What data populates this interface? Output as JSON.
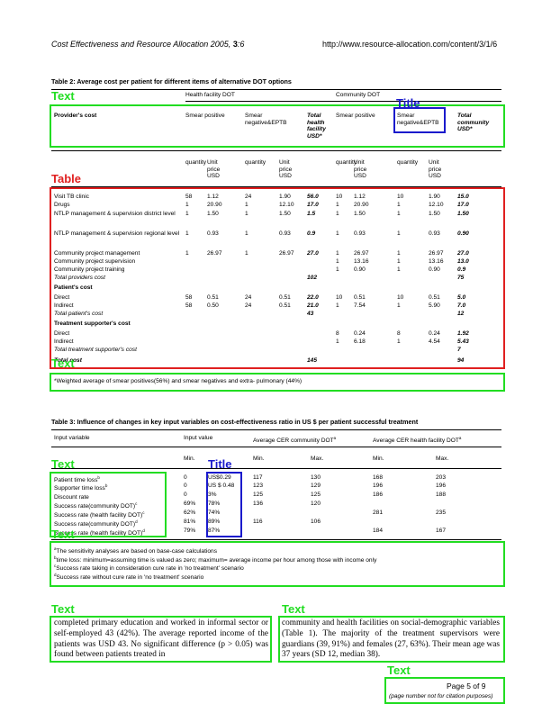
{
  "header": {
    "journal": "Cost Effectiveness and Resource Allocation",
    "citation_year": "2005,",
    "citation_vol": "3",
    "citation_page": ":6",
    "url": "http://www.resource-allocation.com/content/3/1/6"
  },
  "table2": {
    "caption": "Table 2: Average cost per patient for different items of alternative DOT options",
    "group_hf": "Health facility DOT",
    "group_cd": "Community DOT",
    "head_provider": "Provider's cost",
    "head_sp_hf": "Smear positive",
    "head_sn_hf": "Smear negative&EPTB",
    "head_total_hf": "Total health facility USD*",
    "head_sp_cd": "Smear positive",
    "head_sn_cd": "Smear negative&EPTB",
    "head_total_cd": "Total community USD*",
    "sub_qty": "quantity",
    "sub_unit": "Unit price USD",
    "rows": [
      {
        "label": "Visit TB clinic",
        "c": [
          "58",
          "1.12",
          "24",
          "1.90",
          "56.0",
          "10",
          "1.12",
          "10",
          "1.90",
          "15.0"
        ]
      },
      {
        "label": "Drugs",
        "c": [
          "1",
          "20.90",
          "1",
          "12.10",
          "17.0",
          "1",
          "20.90",
          "1",
          "12.10",
          "17.0"
        ]
      },
      {
        "label": "NTLP management & supervision district level",
        "c": [
          "1",
          "1.50",
          "1",
          "1.50",
          "1.5",
          "1",
          "1.50",
          "1",
          "1.50",
          "1.50"
        ]
      },
      {
        "label": "NTLP management & supervision regional level",
        "c": [
          "1",
          "0.93",
          "1",
          "0.93",
          "0.9",
          "1",
          "0.93",
          "1",
          "0.93",
          "0.90"
        ]
      },
      {
        "label": "Community project management",
        "c": [
          "1",
          "26.97",
          "1",
          "26.97",
          "27.0",
          "1",
          "26.97",
          "1",
          "26.97",
          "27.0"
        ]
      },
      {
        "label": "Community project supervision",
        "c": [
          "",
          "",
          "",
          "",
          "",
          "1",
          "13.16",
          "1",
          "13.16",
          "13.0"
        ]
      },
      {
        "label": "Community project training",
        "c": [
          "",
          "",
          "",
          "",
          "",
          "1",
          "0.90",
          "1",
          "0.90",
          "0.9"
        ]
      },
      {
        "label": "Total providers cost",
        "c": [
          "",
          "",
          "",
          "",
          "102",
          "",
          "",
          "",
          "",
          "75"
        ]
      },
      {
        "label": "Patient's cost",
        "c": [
          "",
          "",
          "",
          "",
          "",
          "",
          "",
          "",
          "",
          ""
        ]
      },
      {
        "label": "Direct",
        "c": [
          "58",
          "0.51",
          "24",
          "0.51",
          "22.0",
          "10",
          "0.51",
          "10",
          "0.51",
          "5.0"
        ]
      },
      {
        "label": "Indirect",
        "c": [
          "58",
          "0.50",
          "24",
          "0.51",
          "21.0",
          "1",
          "7.54",
          "1",
          "5.90",
          "7.0"
        ]
      },
      {
        "label": "Total patient's cost",
        "c": [
          "",
          "",
          "",
          "",
          "43",
          "",
          "",
          "",
          "",
          "12"
        ]
      },
      {
        "label": "Treatment supporter's cost",
        "c": [
          "",
          "",
          "",
          "",
          "",
          "",
          "",
          "",
          "",
          ""
        ]
      },
      {
        "label": "Direct",
        "c": [
          "",
          "",
          "",
          "",
          "",
          "8",
          "0.24",
          "8",
          "0.24",
          "1.92"
        ]
      },
      {
        "label": "Indirect",
        "c": [
          "",
          "",
          "",
          "",
          "",
          "1",
          "6.18",
          "1",
          "4.54",
          "5.43"
        ]
      },
      {
        "label": "Total treatment supporter's cost",
        "c": [
          "",
          "",
          "",
          "",
          "",
          "",
          "",
          "",
          "",
          "7"
        ]
      },
      {
        "label": "Total cost",
        "c": [
          "",
          "",
          "",
          "",
          "145",
          "",
          "",
          "",
          "",
          "94"
        ]
      }
    ],
    "footnote": "*Weighted average of smear positives(56%) and smear negatives and extra- pulmonary (44%)"
  },
  "table3": {
    "caption": "Table 3: Influence of changes in key input variables on cost-effectiveness ratio in US $ per patient successful treatment",
    "head_variable": "Input variable",
    "head_value": "Input value",
    "head_cd": "Average CER community DOT",
    "head_hf": "Average CER health facility DOT",
    "head_sup": "a",
    "sub_min": "Min.",
    "sub_max": "Max.",
    "sub_value": "Title",
    "rows": [
      {
        "label": "Patient time loss",
        "sup": "b",
        "min": "0",
        "max": "US$0.29",
        "cd_min": "117",
        "cd_max": "130",
        "hf_min": "168",
        "hf_max": "203"
      },
      {
        "label": "Supporter time loss",
        "sup": "b",
        "min": "0",
        "max": "US $ 0.48",
        "cd_min": "123",
        "cd_max": "129",
        "hf_min": "196",
        "hf_max": "196"
      },
      {
        "label": "Discount rate",
        "sup": "",
        "min": "0",
        "max": "3%",
        "cd_min": "125",
        "cd_max": "125",
        "hf_min": "186",
        "hf_max": "188"
      },
      {
        "label": "Success rate(community DOT)",
        "sup": "c",
        "min": "69%",
        "max": "78%",
        "cd_min": "136",
        "cd_max": "120",
        "hf_min": "",
        "hf_max": ""
      },
      {
        "label": "Success rate (health facility DOT)",
        "sup": "c",
        "min": "62%",
        "max": "74%",
        "cd_min": "",
        "cd_max": "",
        "hf_min": "281",
        "hf_max": "235"
      },
      {
        "label": "Success rate(community DOT)",
        "sup": "d",
        "min": "81%",
        "max": "89%",
        "cd_min": "116",
        "cd_max": "106",
        "hf_min": "",
        "hf_max": ""
      },
      {
        "label": "Success rate (health facility DOT)",
        "sup": "d",
        "min": "79%",
        "max": "87%",
        "cd_min": "",
        "cd_max": "",
        "hf_min": "184",
        "hf_max": "167"
      }
    ],
    "notes": [
      {
        "sup": "a",
        "text": "The sensitivity analyses are based on base-case calculations"
      },
      {
        "sup": "b",
        "text": "time loss: minimum=assuming time is valued as zero; maximum= average income per hour among those with income only"
      },
      {
        "sup": "c",
        "text": "Success rate taking in consideration cure rate in 'no treatment' scenario"
      },
      {
        "sup": "d",
        "text": "Success rate without cure rate in 'no treatment' scenario"
      }
    ]
  },
  "body": {
    "left": "completed primary education and worked in informal sector or self-employed 43 (42%). The average reported income of the patients was USD 43. No significant difference (p > 0.05) was found between patients treated in",
    "right": "community and health facilities on social-demographic variables (Table 1). The majority of the treatment supervisors were guardians (39, 91%) and females (27, 63%). Their mean age was 37 years (SD 12, median 38)."
  },
  "footer": {
    "page": "Page 5 of 9",
    "note": "(page number not for citation purposes)"
  },
  "annotations": {
    "text": "Text",
    "title": "Title",
    "table": "Table",
    "colors": {
      "text": "#22dd22",
      "table": "#e02020",
      "title": "#1a1acc"
    }
  }
}
